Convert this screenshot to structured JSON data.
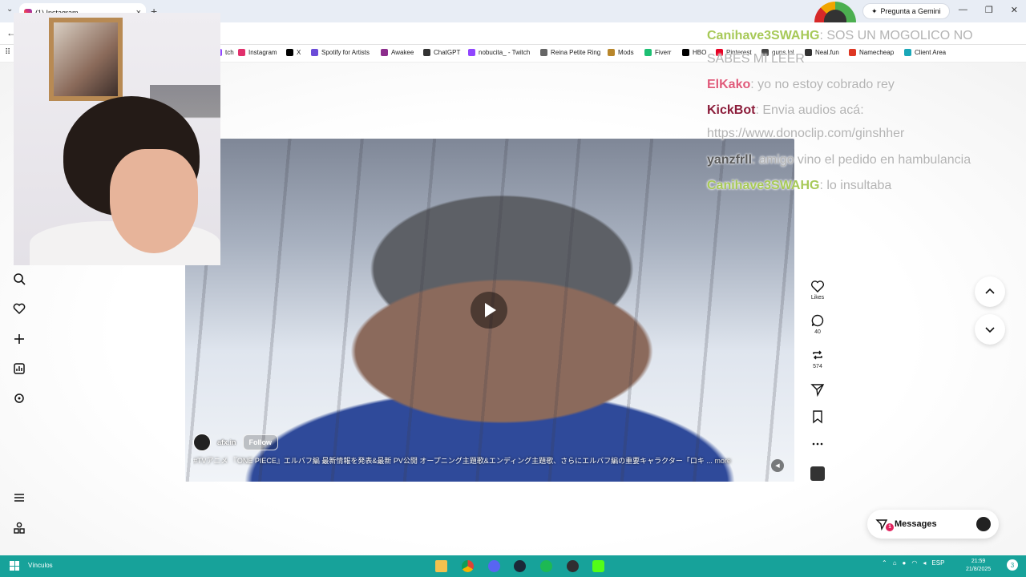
{
  "browser": {
    "tab_title": "(1) Instagram",
    "gemini_label": "Pregunta a Gemini",
    "bookmarks": [
      {
        "label": "tch",
        "color": "#9146ff"
      },
      {
        "label": "Instagram",
        "color": "#e1306c"
      },
      {
        "label": "X",
        "color": "#000000"
      },
      {
        "label": "Spotify for Artists",
        "color": "#6b4bd8"
      },
      {
        "label": "Awakee",
        "color": "#8c2d8c"
      },
      {
        "label": "ChatGPT",
        "color": "#333333"
      },
      {
        "label": "nobucita_ - Twitch",
        "color": "#9146ff"
      },
      {
        "label": "Reina Petite Ring",
        "color": "#666666"
      },
      {
        "label": "Mods",
        "color": "#b8862b"
      },
      {
        "label": "Fiverr",
        "color": "#1dbf73"
      },
      {
        "label": "HBO",
        "color": "#000000"
      },
      {
        "label": "Pinterest",
        "color": "#e60023"
      },
      {
        "label": "guns.lol",
        "color": "#444444"
      },
      {
        "label": "Neal.fun",
        "color": "#333333"
      },
      {
        "label": "Namecheap",
        "color": "#de3723"
      },
      {
        "label": "Client Area",
        "color": "#1aa7b8"
      }
    ]
  },
  "post": {
    "author": "afx.in",
    "follow_label": "Follow",
    "caption": "#TVアニメ 『ONE PIECE』エルバフ編 最新情報を発表&最新 PV公開 オープニング主題歌&エンディング主題歌、さらにエルバフ編の重要キャラクター「ロキ ...",
    "more_label": "more"
  },
  "actions": {
    "likes_label": "Likes",
    "comments_count": "40",
    "reposts_count": "574"
  },
  "messages": {
    "label": "Messages",
    "badge": "1"
  },
  "chat": [
    {
      "user": "Canihave3SWAHG",
      "text": ": SOS UN MOGOLICO NO",
      "color": "#a7c957"
    },
    {
      "user": "",
      "text": "SABES MI LEER",
      "color": "#a7c957"
    },
    {
      "user": "ElKako",
      "text": ": yo no estoy cobrado rey",
      "color": "#e05a7a"
    },
    {
      "user": "KickBot",
      "text": ": Envia audios acá:",
      "color": "#8b1c3a"
    },
    {
      "user": "",
      "text": "https://www.donoclip.com/ginshher",
      "color": "#8b1c3a"
    },
    {
      "user": "yanzfrll",
      "text": ": amigo vino el pedido en hambulancia",
      "color": "#5a5a5a"
    },
    {
      "user": "Canihave3SWAHG",
      "text": ": lo insultaba",
      "color": "#a7c957"
    }
  ],
  "taskbar": {
    "vinculos_label": "Vínculos",
    "lang": "ESP",
    "time": "21:59",
    "date": "21/8/2025",
    "notifications": "3"
  }
}
